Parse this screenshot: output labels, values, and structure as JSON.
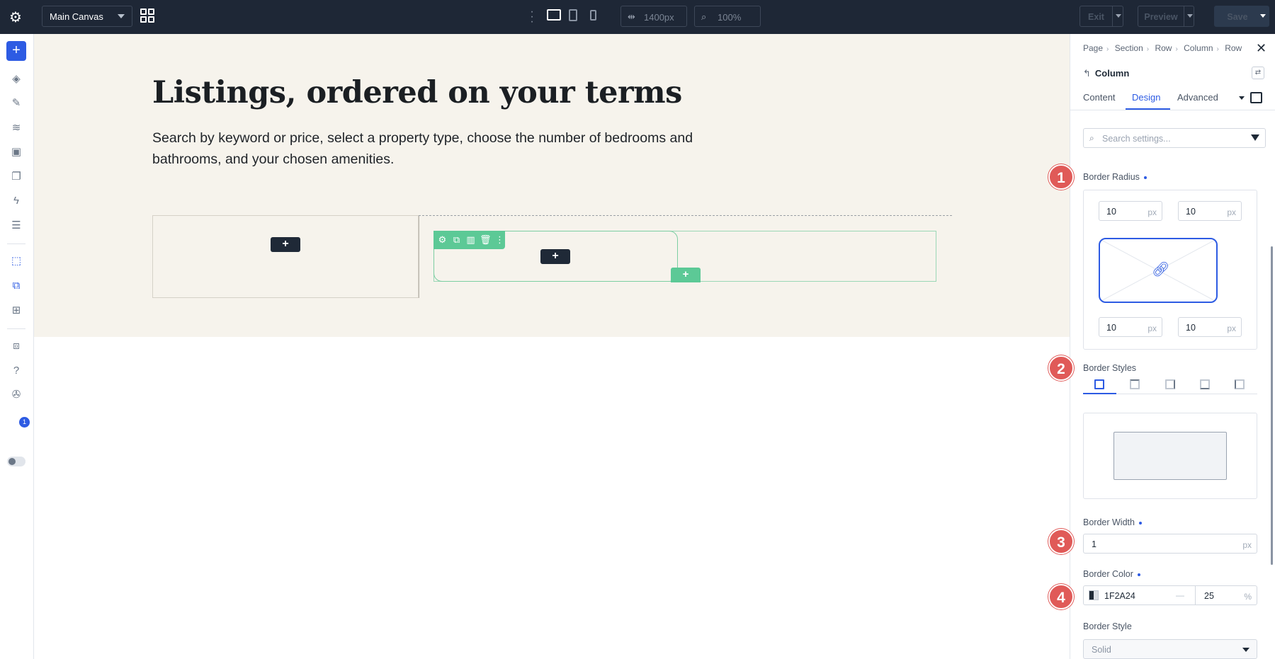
{
  "topbar": {
    "canvas_label": "Main Canvas",
    "width_value": "1400px",
    "zoom_value": "100%",
    "exit_label": "Exit",
    "preview_label": "Preview",
    "save_label": "Save"
  },
  "leftbar": {
    "add_label": "+",
    "notifications_count": "1"
  },
  "canvas": {
    "heading": "Listings, ordered on your terms",
    "lead": "Search by keyword or price, select a property type, choose the number of bedrooms and bathrooms, and your chosen amenities.",
    "add_label": "+"
  },
  "panel": {
    "breadcrumbs": [
      "Page",
      "Section",
      "Row",
      "Column",
      "Row"
    ],
    "element_name": "Column",
    "tabs": [
      "Content",
      "Design",
      "Advanced"
    ],
    "active_tab": "Design",
    "search_placeholder": "Search settings...",
    "border_radius": {
      "label": "Border Radius",
      "top_left": "10",
      "top_right": "10",
      "bottom_left": "10",
      "bottom_right": "10",
      "unit": "px"
    },
    "border_styles": {
      "label": "Border Styles"
    },
    "border_width": {
      "label": "Border Width",
      "value": "1",
      "unit": "px"
    },
    "border_color": {
      "label": "Border Color",
      "hex": "1F2A24",
      "dash": "—",
      "opacity": "25",
      "unit": "%"
    },
    "border_style": {
      "label": "Border Style",
      "value": "Solid"
    }
  },
  "markers": [
    "1",
    "2",
    "3",
    "4"
  ],
  "colors": {
    "topbar_bg": "#1e2736",
    "accent_blue": "#2d5be3",
    "builder_green": "#5cc996",
    "section_bg": "#f6f3ec",
    "marker_red": "#e05a58"
  }
}
